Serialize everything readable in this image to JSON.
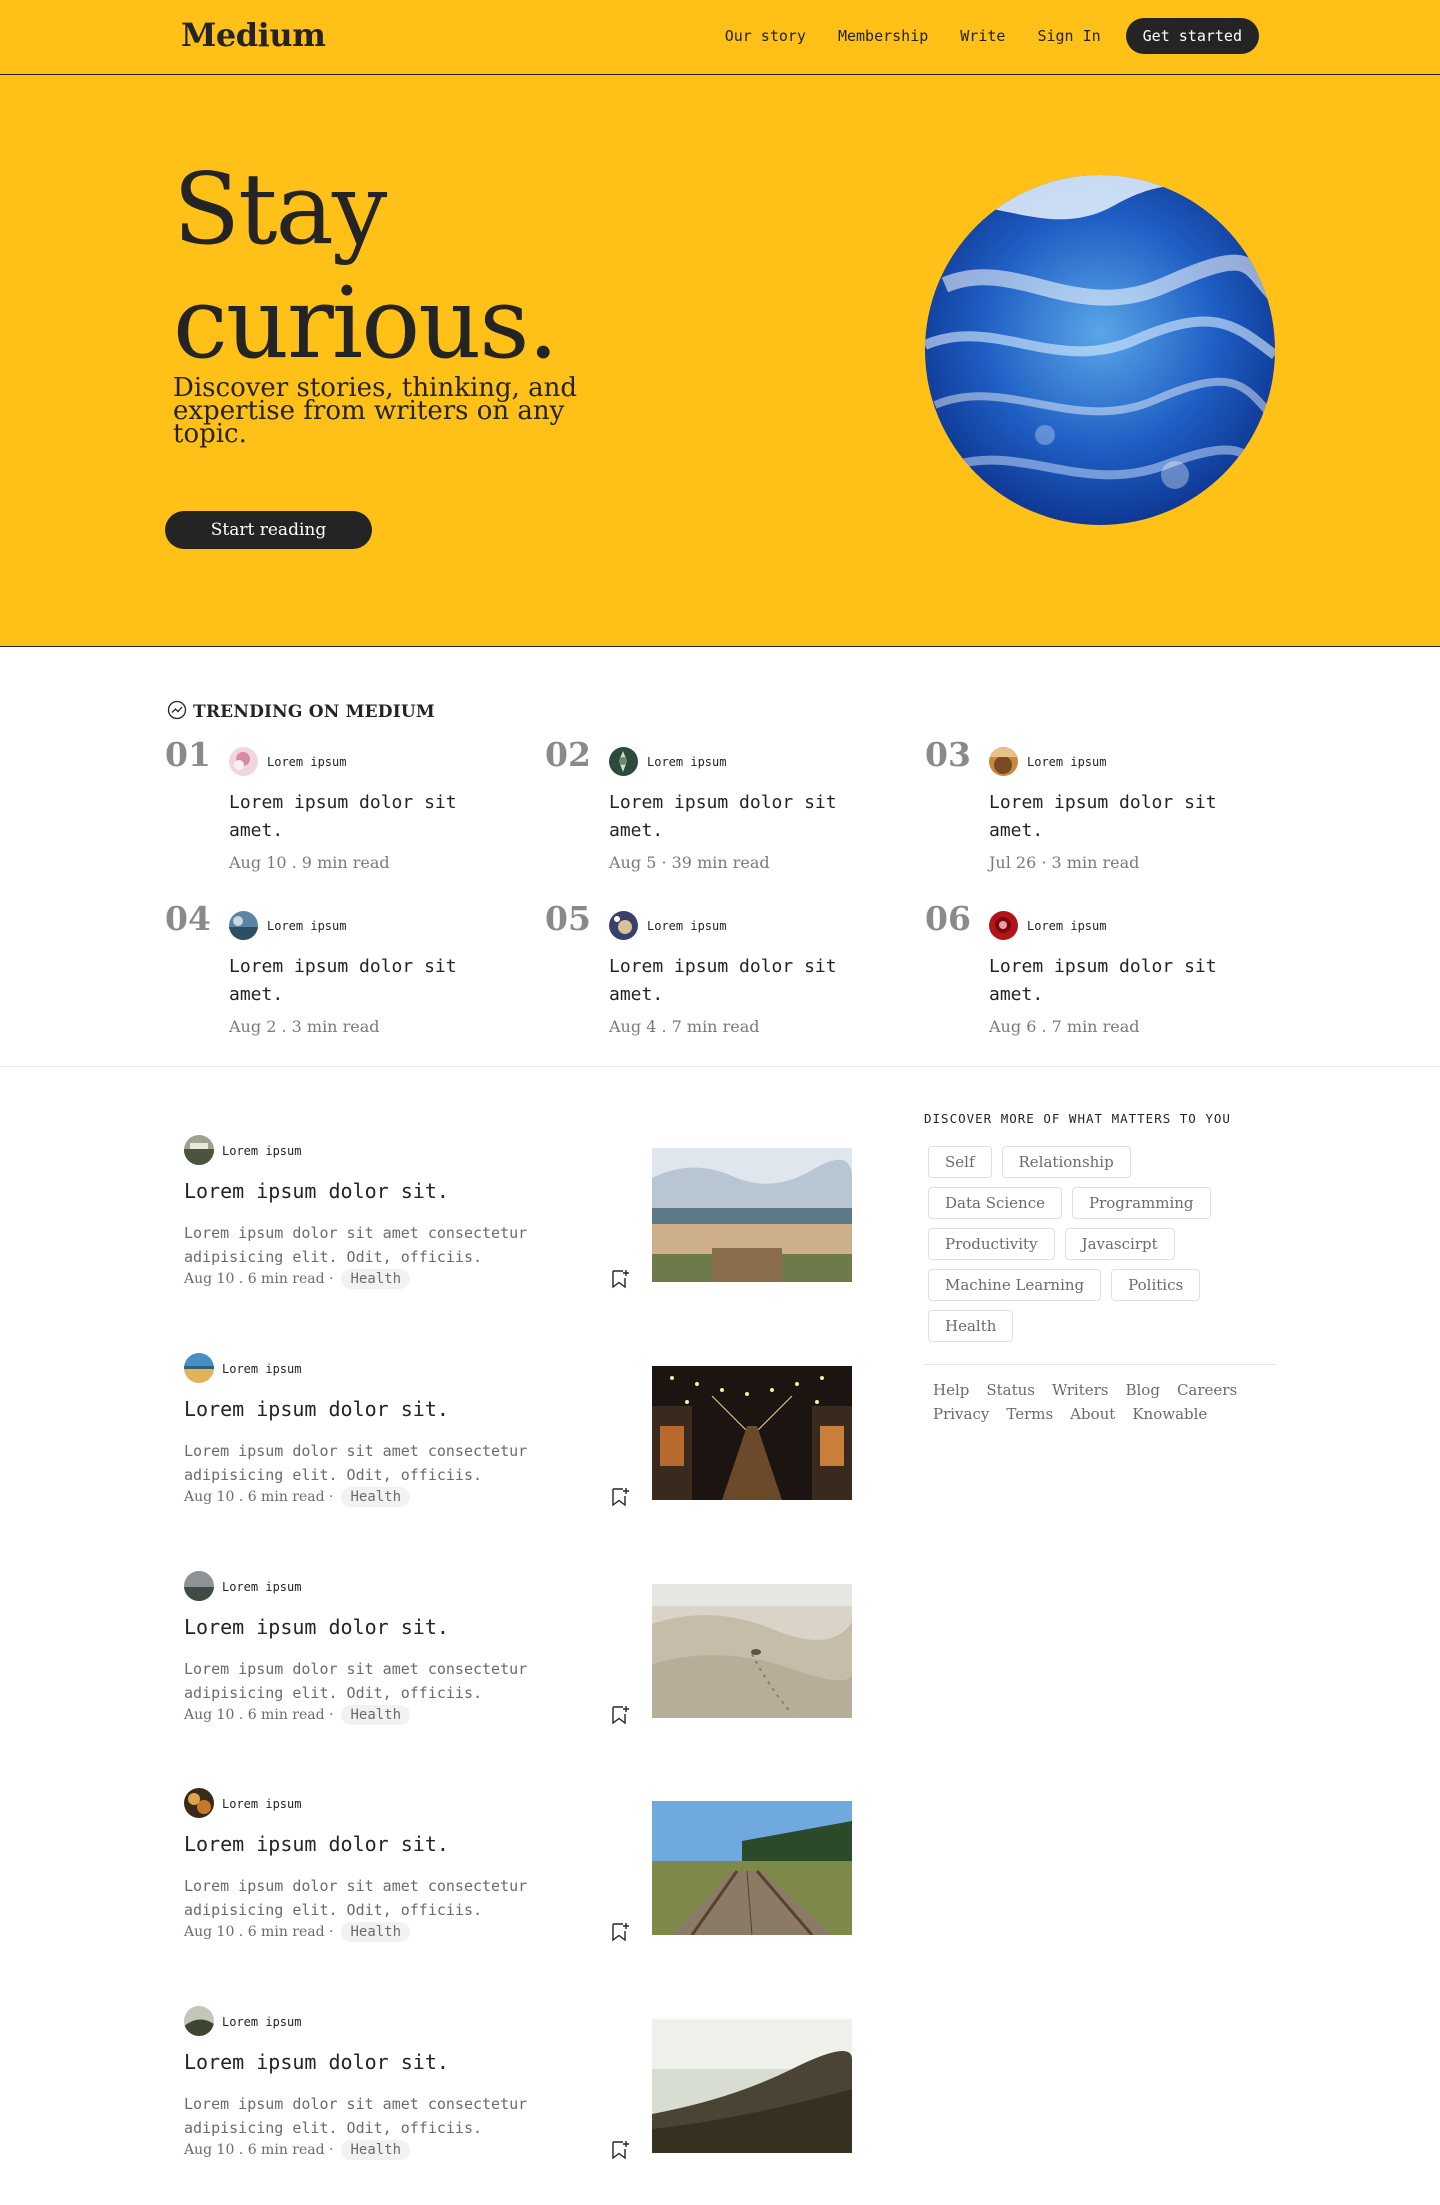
{
  "header": {
    "logo": "Medium",
    "nav": [
      "Our story",
      "Membership",
      "Write",
      "Sign In"
    ],
    "cta": "Get started"
  },
  "hero": {
    "title_line1": "Stay",
    "title_line2": "curious.",
    "subtitle": "Discover stories, thinking, and expertise from writers on any topic.",
    "button": "Start reading"
  },
  "trending": {
    "heading": "TRENDING ON MEDIUM",
    "items": [
      {
        "num": "01",
        "author": "Lorem ipsum",
        "title": "Lorem ipsum dolor sit amet.",
        "meta": "Aug 10 . 9 min read"
      },
      {
        "num": "02",
        "author": "Lorem ipsum",
        "title": "Lorem ipsum dolor sit amet.",
        "meta": "Aug 5 · 39 min read"
      },
      {
        "num": "03",
        "author": "Lorem ipsum",
        "title": "Lorem ipsum dolor sit amet.",
        "meta": "Jul 26 · 3 min read"
      },
      {
        "num": "04",
        "author": "Lorem ipsum",
        "title": "Lorem ipsum dolor sit amet.",
        "meta": "Aug 2 . 3 min read"
      },
      {
        "num": "05",
        "author": "Lorem ipsum",
        "title": "Lorem ipsum dolor sit amet.",
        "meta": "Aug 4 . 7 min read"
      },
      {
        "num": "06",
        "author": "Lorem ipsum",
        "title": "Lorem ipsum dolor sit amet.",
        "meta": "Aug 6 . 7 min read"
      }
    ]
  },
  "feed": {
    "posts": [
      {
        "author": "Lorem ipsum",
        "title": "Lorem ipsum dolor sit.",
        "excerpt": "Lorem ipsum dolor sit amet consectetur adipisicing elit. Odit, officiis.",
        "meta": "Aug 10 . 6 min read ·",
        "tag": "Health"
      },
      {
        "author": "Lorem ipsum",
        "title": "Lorem ipsum dolor sit.",
        "excerpt": "Lorem ipsum dolor sit amet consectetur adipisicing elit. Odit, officiis.",
        "meta": "Aug 10 . 6 min read ·",
        "tag": "Health"
      },
      {
        "author": "Lorem ipsum",
        "title": "Lorem ipsum dolor sit.",
        "excerpt": "Lorem ipsum dolor sit amet consectetur adipisicing elit. Odit, officiis.",
        "meta": "Aug 10 . 6 min read ·",
        "tag": "Health"
      },
      {
        "author": "Lorem ipsum",
        "title": "Lorem ipsum dolor sit.",
        "excerpt": "Lorem ipsum dolor sit amet consectetur adipisicing elit. Odit, officiis.",
        "meta": "Aug 10 . 6 min read ·",
        "tag": "Health"
      },
      {
        "author": "Lorem ipsum",
        "title": "Lorem ipsum dolor sit.",
        "excerpt": "Lorem ipsum dolor sit amet consectetur adipisicing elit. Odit, officiis.",
        "meta": "Aug 10 . 6 min read ·",
        "tag": "Health"
      }
    ]
  },
  "sidebar": {
    "heading": "DISCOVER MORE OF WHAT MATTERS TO YOU",
    "tags": [
      "Self",
      "Relationship",
      "Data Science",
      "Programming",
      "Productivity",
      "Javascirpt",
      "Machine Learning",
      "Politics",
      "Health"
    ],
    "footer_links": [
      "Help",
      "Status",
      "Writers",
      "Blog",
      "Careers",
      "Privacy",
      "Terms",
      "About",
      "Knowable"
    ]
  },
  "colors": {
    "brand_yellow": "#ffc017",
    "ink": "#242424",
    "muted": "#6b6b6b"
  }
}
